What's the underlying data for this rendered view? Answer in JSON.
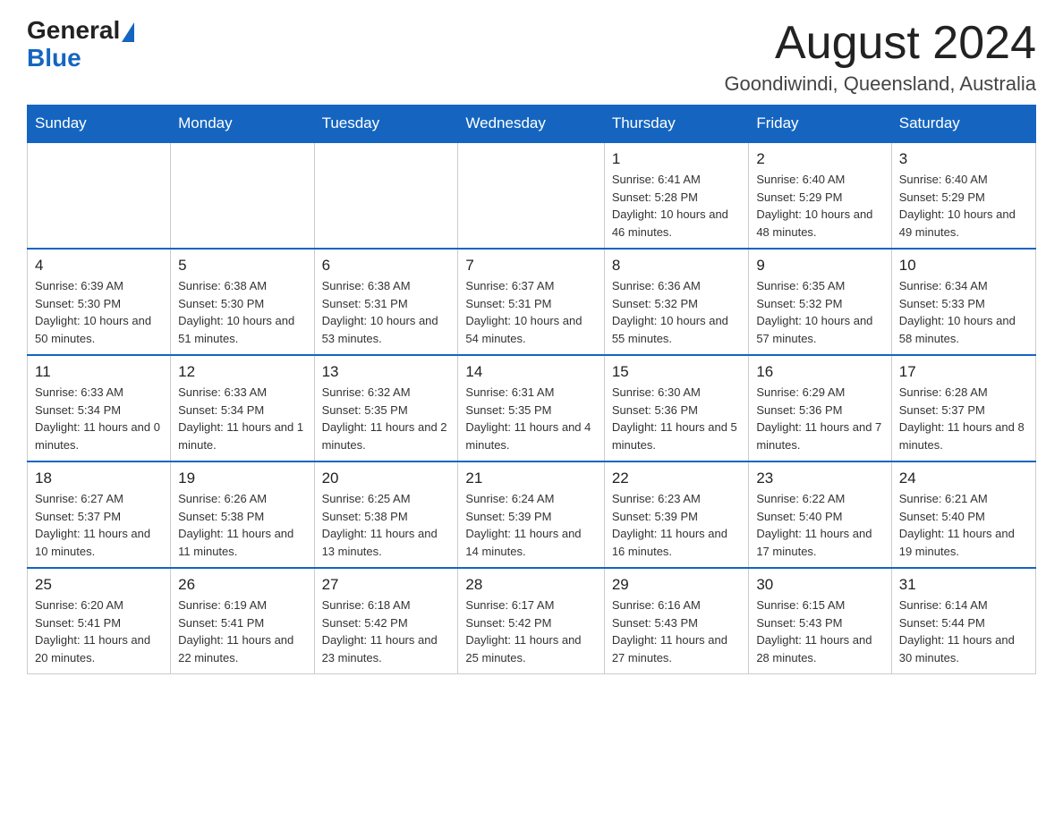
{
  "header": {
    "logo_general": "General",
    "logo_blue": "Blue",
    "month_title": "August 2024",
    "location": "Goondiwindi, Queensland, Australia"
  },
  "days_of_week": [
    "Sunday",
    "Monday",
    "Tuesday",
    "Wednesday",
    "Thursday",
    "Friday",
    "Saturday"
  ],
  "weeks": [
    {
      "days": [
        {
          "number": "",
          "info": ""
        },
        {
          "number": "",
          "info": ""
        },
        {
          "number": "",
          "info": ""
        },
        {
          "number": "",
          "info": ""
        },
        {
          "number": "1",
          "info": "Sunrise: 6:41 AM\nSunset: 5:28 PM\nDaylight: 10 hours and 46 minutes."
        },
        {
          "number": "2",
          "info": "Sunrise: 6:40 AM\nSunset: 5:29 PM\nDaylight: 10 hours and 48 minutes."
        },
        {
          "number": "3",
          "info": "Sunrise: 6:40 AM\nSunset: 5:29 PM\nDaylight: 10 hours and 49 minutes."
        }
      ]
    },
    {
      "days": [
        {
          "number": "4",
          "info": "Sunrise: 6:39 AM\nSunset: 5:30 PM\nDaylight: 10 hours and 50 minutes."
        },
        {
          "number": "5",
          "info": "Sunrise: 6:38 AM\nSunset: 5:30 PM\nDaylight: 10 hours and 51 minutes."
        },
        {
          "number": "6",
          "info": "Sunrise: 6:38 AM\nSunset: 5:31 PM\nDaylight: 10 hours and 53 minutes."
        },
        {
          "number": "7",
          "info": "Sunrise: 6:37 AM\nSunset: 5:31 PM\nDaylight: 10 hours and 54 minutes."
        },
        {
          "number": "8",
          "info": "Sunrise: 6:36 AM\nSunset: 5:32 PM\nDaylight: 10 hours and 55 minutes."
        },
        {
          "number": "9",
          "info": "Sunrise: 6:35 AM\nSunset: 5:32 PM\nDaylight: 10 hours and 57 minutes."
        },
        {
          "number": "10",
          "info": "Sunrise: 6:34 AM\nSunset: 5:33 PM\nDaylight: 10 hours and 58 minutes."
        }
      ]
    },
    {
      "days": [
        {
          "number": "11",
          "info": "Sunrise: 6:33 AM\nSunset: 5:34 PM\nDaylight: 11 hours and 0 minutes."
        },
        {
          "number": "12",
          "info": "Sunrise: 6:33 AM\nSunset: 5:34 PM\nDaylight: 11 hours and 1 minute."
        },
        {
          "number": "13",
          "info": "Sunrise: 6:32 AM\nSunset: 5:35 PM\nDaylight: 11 hours and 2 minutes."
        },
        {
          "number": "14",
          "info": "Sunrise: 6:31 AM\nSunset: 5:35 PM\nDaylight: 11 hours and 4 minutes."
        },
        {
          "number": "15",
          "info": "Sunrise: 6:30 AM\nSunset: 5:36 PM\nDaylight: 11 hours and 5 minutes."
        },
        {
          "number": "16",
          "info": "Sunrise: 6:29 AM\nSunset: 5:36 PM\nDaylight: 11 hours and 7 minutes."
        },
        {
          "number": "17",
          "info": "Sunrise: 6:28 AM\nSunset: 5:37 PM\nDaylight: 11 hours and 8 minutes."
        }
      ]
    },
    {
      "days": [
        {
          "number": "18",
          "info": "Sunrise: 6:27 AM\nSunset: 5:37 PM\nDaylight: 11 hours and 10 minutes."
        },
        {
          "number": "19",
          "info": "Sunrise: 6:26 AM\nSunset: 5:38 PM\nDaylight: 11 hours and 11 minutes."
        },
        {
          "number": "20",
          "info": "Sunrise: 6:25 AM\nSunset: 5:38 PM\nDaylight: 11 hours and 13 minutes."
        },
        {
          "number": "21",
          "info": "Sunrise: 6:24 AM\nSunset: 5:39 PM\nDaylight: 11 hours and 14 minutes."
        },
        {
          "number": "22",
          "info": "Sunrise: 6:23 AM\nSunset: 5:39 PM\nDaylight: 11 hours and 16 minutes."
        },
        {
          "number": "23",
          "info": "Sunrise: 6:22 AM\nSunset: 5:40 PM\nDaylight: 11 hours and 17 minutes."
        },
        {
          "number": "24",
          "info": "Sunrise: 6:21 AM\nSunset: 5:40 PM\nDaylight: 11 hours and 19 minutes."
        }
      ]
    },
    {
      "days": [
        {
          "number": "25",
          "info": "Sunrise: 6:20 AM\nSunset: 5:41 PM\nDaylight: 11 hours and 20 minutes."
        },
        {
          "number": "26",
          "info": "Sunrise: 6:19 AM\nSunset: 5:41 PM\nDaylight: 11 hours and 22 minutes."
        },
        {
          "number": "27",
          "info": "Sunrise: 6:18 AM\nSunset: 5:42 PM\nDaylight: 11 hours and 23 minutes."
        },
        {
          "number": "28",
          "info": "Sunrise: 6:17 AM\nSunset: 5:42 PM\nDaylight: 11 hours and 25 minutes."
        },
        {
          "number": "29",
          "info": "Sunrise: 6:16 AM\nSunset: 5:43 PM\nDaylight: 11 hours and 27 minutes."
        },
        {
          "number": "30",
          "info": "Sunrise: 6:15 AM\nSunset: 5:43 PM\nDaylight: 11 hours and 28 minutes."
        },
        {
          "number": "31",
          "info": "Sunrise: 6:14 AM\nSunset: 5:44 PM\nDaylight: 11 hours and 30 minutes."
        }
      ]
    }
  ]
}
